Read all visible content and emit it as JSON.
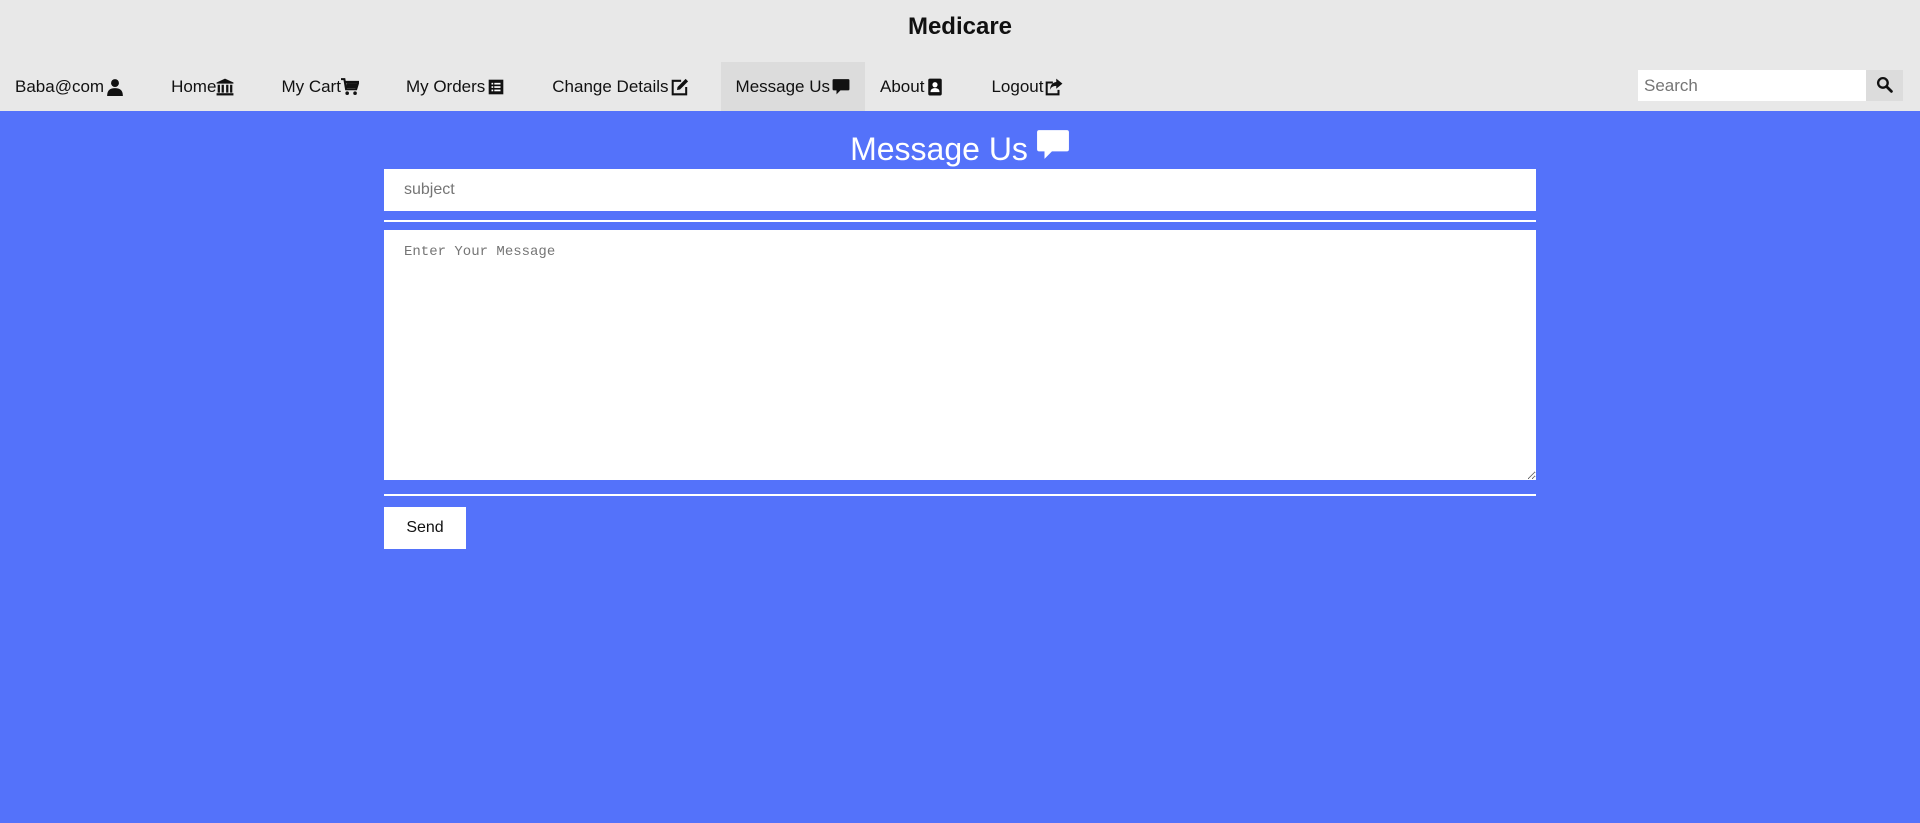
{
  "header": {
    "brand": "Medicare"
  },
  "nav": {
    "items": [
      {
        "label": "Baba@com",
        "icon": "user-icon"
      },
      {
        "label": "Home",
        "icon": "bank-icon"
      },
      {
        "label": "My Cart",
        "icon": "cart-icon"
      },
      {
        "label": "My Orders",
        "icon": "list-icon"
      },
      {
        "label": "Change Details",
        "icon": "edit-icon"
      },
      {
        "label": "Message Us",
        "icon": "comment-icon",
        "active": true
      },
      {
        "label": "About",
        "icon": "contact-card-icon"
      },
      {
        "label": "Logout",
        "icon": "share-icon"
      }
    ]
  },
  "search": {
    "placeholder": "Search"
  },
  "page": {
    "title": "Message Us"
  },
  "form": {
    "subject_placeholder": "subject",
    "message_placeholder": "Enter Your Message",
    "send_label": "Send"
  },
  "colors": {
    "background": "#5472fa",
    "header": "#e8e8e8",
    "active_nav": "#dcdcdc"
  }
}
